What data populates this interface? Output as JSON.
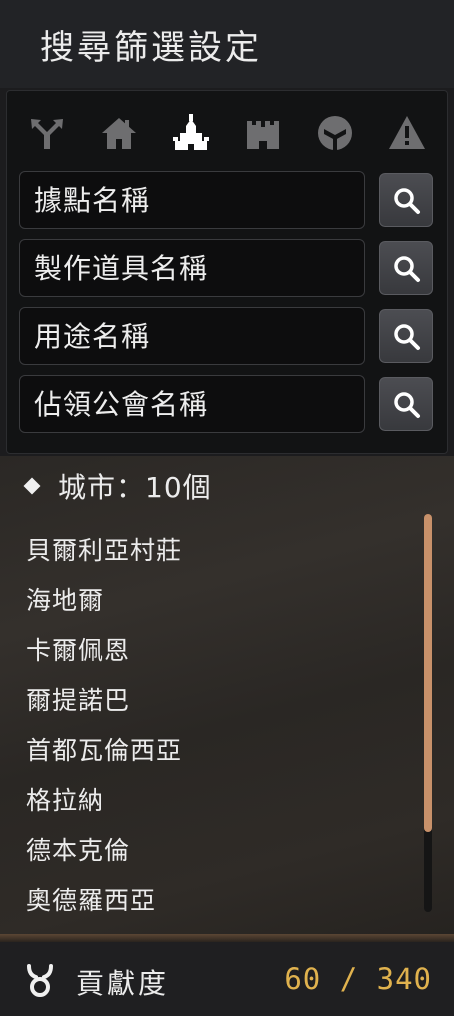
{
  "header": {
    "title": "搜尋篩選設定"
  },
  "category_icons": [
    {
      "name": "crossroad-icon",
      "active": false
    },
    {
      "name": "house-icon",
      "active": false
    },
    {
      "name": "city-icon",
      "active": true
    },
    {
      "name": "castle-icon",
      "active": false
    },
    {
      "name": "gateway-icon",
      "active": false
    },
    {
      "name": "danger-icon",
      "active": false
    }
  ],
  "search": {
    "node_name": {
      "placeholder": "據點名稱",
      "value": ""
    },
    "crafted_item": {
      "placeholder": "製作道具名稱",
      "value": ""
    },
    "usage": {
      "placeholder": "用途名稱",
      "value": ""
    },
    "guild": {
      "placeholder": "佔領公會名稱",
      "value": ""
    }
  },
  "cities": {
    "header": "城市：10個",
    "items": [
      "貝爾利亞村莊",
      "海地爾",
      "卡爾佩恩",
      "爾提諾巴",
      "首都瓦倫西亞",
      "格拉納",
      "德本克倫",
      "奧德羅西亞"
    ]
  },
  "footer": {
    "label": "貢獻度",
    "value": "60 / 340"
  },
  "colors": {
    "accent_gold": "#e0b24e",
    "scrollbar_thumb": "#c8916a",
    "icon_inactive": "#6e6e70",
    "icon_active": "#ffffff"
  }
}
